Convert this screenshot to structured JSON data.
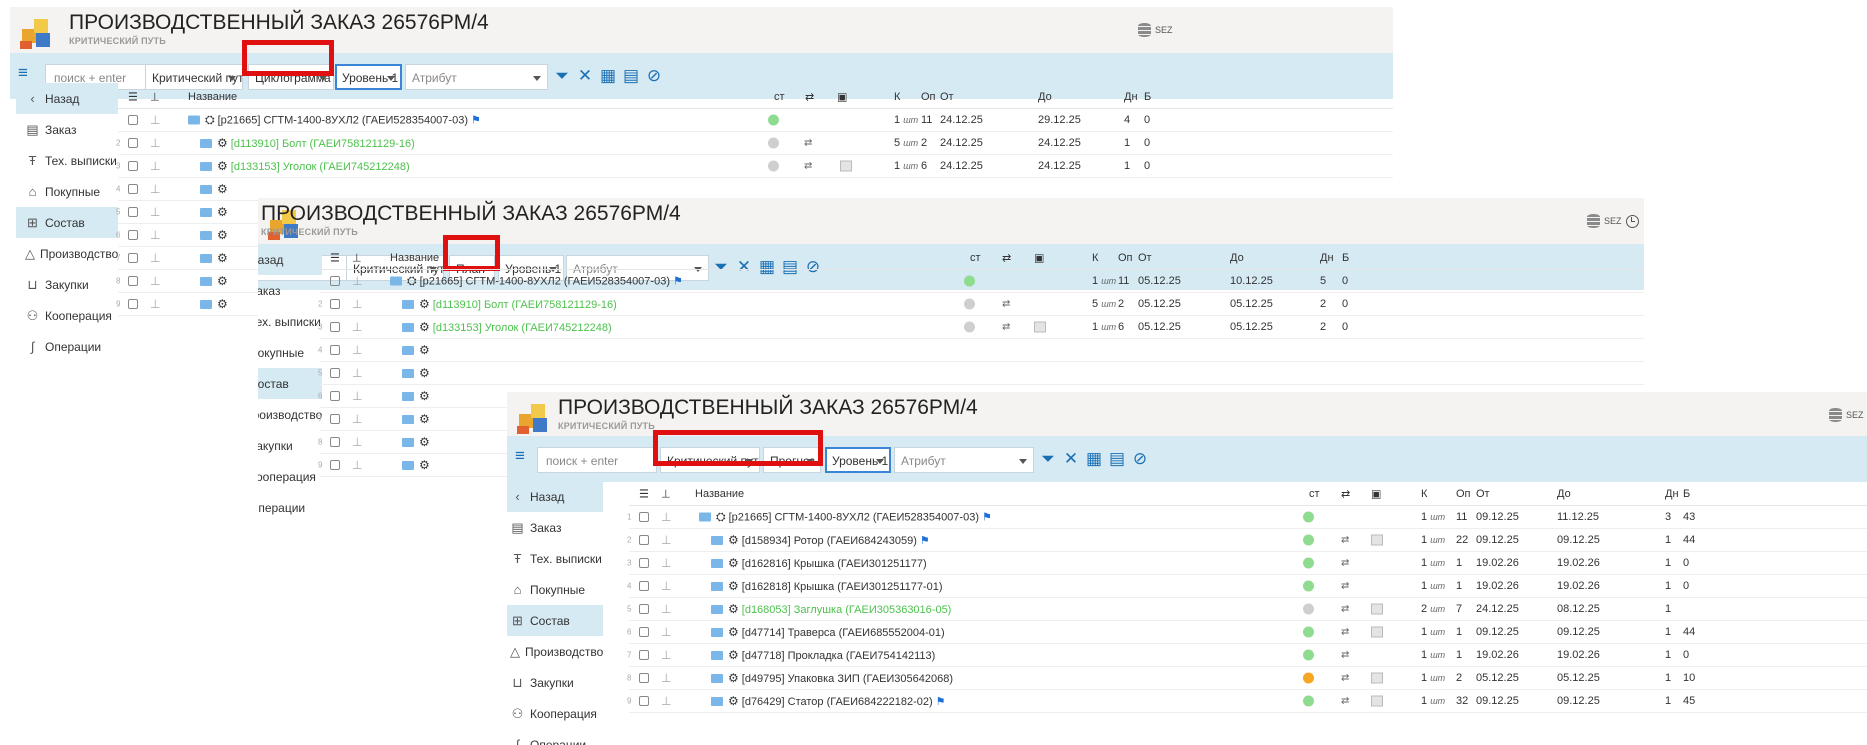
{
  "header": {
    "title": "ПРОИЗВОДСТВЕННЫЙ ЗАКАЗ 26576РМ/4",
    "subtitle": "КРИТИЧЕСКИЙ ПУТЬ",
    "db_label": "SEZ"
  },
  "toolbar": {
    "search_placeholder": "поиск + enter",
    "path": "Критический путь",
    "level": "Уровень 1",
    "attribute": "Атрибут"
  },
  "views": {
    "p1": "Циклограмма",
    "p2": "План",
    "p3": "Прогноз"
  },
  "sidebar": {
    "items": [
      {
        "label": "Назад",
        "icon": "chevron-left-icon"
      },
      {
        "label": "Заказ",
        "icon": "document-icon"
      },
      {
        "label": "Тех. выписки",
        "icon": "text-icon"
      },
      {
        "label": "Покупные",
        "icon": "bag-icon"
      },
      {
        "label": "Состав",
        "icon": "structure-icon"
      },
      {
        "label": "Производство",
        "icon": "shapes-icon"
      },
      {
        "label": "Закупки",
        "icon": "cart-icon"
      },
      {
        "label": "Кооперация",
        "icon": "people-icon"
      },
      {
        "label": "Операции",
        "icon": "operations-icon"
      }
    ]
  },
  "table": {
    "columns": {
      "name": "Название",
      "st": "ст",
      "k": "К",
      "op": "Оп",
      "from": "От",
      "to": "До",
      "days": "Дн",
      "b": "Б"
    },
    "unit": "шт"
  },
  "p1_rows": [
    {
      "n": "",
      "name": "[p21665] СГТМ-1400-8УХЛ2 (ГАЕИ528354007-03)",
      "green": false,
      "flag": true,
      "st": "g",
      "rs": false,
      "img": false,
      "k": "1",
      "op": "11",
      "from": "24.12.25",
      "to": "29.12.25",
      "d": "4",
      "b": "0",
      "lvl": 0
    },
    {
      "n": "2",
      "name": "[d113910] Болт (ГАЕИ758121129-16)",
      "green": true,
      "flag": false,
      "st": "gr",
      "rs": true,
      "img": false,
      "k": "5",
      "op": "2",
      "from": "24.12.25",
      "to": "24.12.25",
      "d": "1",
      "b": "0",
      "lvl": 1
    },
    {
      "n": "3",
      "name": "[d133153] Уголок (ГАЕИ745212248)",
      "green": true,
      "flag": false,
      "st": "gr",
      "rs": true,
      "img": true,
      "k": "1",
      "op": "6",
      "from": "24.12.25",
      "to": "24.12.25",
      "d": "1",
      "b": "0",
      "lvl": 1
    }
  ],
  "p2_rows": [
    {
      "n": "",
      "name": "[p21665] СГТМ-1400-8УХЛ2 (ГАЕИ528354007-03)",
      "green": false,
      "flag": true,
      "st": "g",
      "rs": false,
      "img": false,
      "k": "1",
      "op": "11",
      "from": "05.12.25",
      "to": "10.12.25",
      "d": "5",
      "b": "0",
      "lvl": 0
    },
    {
      "n": "2",
      "name": "[d113910] Болт (ГАЕИ758121129-16)",
      "green": true,
      "flag": false,
      "st": "gr",
      "rs": true,
      "img": false,
      "k": "5",
      "op": "2",
      "from": "05.12.25",
      "to": "05.12.25",
      "d": "2",
      "b": "0",
      "lvl": 1
    },
    {
      "n": "3",
      "name": "[d133153] Уголок (ГАЕИ745212248)",
      "green": true,
      "flag": false,
      "st": "gr",
      "rs": true,
      "img": true,
      "k": "1",
      "op": "6",
      "from": "05.12.25",
      "to": "05.12.25",
      "d": "2",
      "b": "0",
      "lvl": 1
    }
  ],
  "p3_rows": [
    {
      "n": "1",
      "name": "[p21665] СГТМ-1400-8УХЛ2 (ГАЕИ528354007-03)",
      "green": false,
      "flag": true,
      "st": "g",
      "rs": false,
      "img": false,
      "k": "1",
      "op": "11",
      "from": "09.12.25",
      "to": "11.12.25",
      "d": "3",
      "b": "43",
      "lvl": 0
    },
    {
      "n": "2",
      "name": "[d158934] Ротор (ГАЕИ684243059)",
      "green": false,
      "flag": true,
      "st": "g",
      "rs": true,
      "img": true,
      "k": "1",
      "op": "22",
      "from": "09.12.25",
      "to": "09.12.25",
      "d": "1",
      "b": "44",
      "lvl": 1
    },
    {
      "n": "3",
      "name": "[d162816] Крышка (ГАЕИ301251177)",
      "green": false,
      "flag": false,
      "st": "g",
      "rs": true,
      "img": false,
      "k": "1",
      "op": "1",
      "from": "19.02.26",
      "to": "19.02.26",
      "d": "1",
      "b": "0",
      "lvl": 1
    },
    {
      "n": "4",
      "name": "[d162818] Крышка (ГАЕИ301251177-01)",
      "green": false,
      "flag": false,
      "st": "g",
      "rs": true,
      "img": false,
      "k": "1",
      "op": "1",
      "from": "19.02.26",
      "to": "19.02.26",
      "d": "1",
      "b": "0",
      "lvl": 1
    },
    {
      "n": "5",
      "name": "[d168053] Заглушка (ГАЕИ305363016-05)",
      "green": true,
      "flag": false,
      "st": "gr",
      "rs": true,
      "img": true,
      "k": "2",
      "op": "7",
      "from": "24.12.25",
      "to": "08.12.25",
      "d": "1",
      "b": "",
      "lvl": 1
    },
    {
      "n": "6",
      "name": "[d47714] Траверса (ГАЕИ685552004-01)",
      "green": false,
      "flag": false,
      "st": "g",
      "rs": true,
      "img": true,
      "k": "1",
      "op": "1",
      "from": "09.12.25",
      "to": "09.12.25",
      "d": "1",
      "b": "44",
      "lvl": 1
    },
    {
      "n": "7",
      "name": "[d47718] Прокладка (ГАЕИ754142113)",
      "green": false,
      "flag": false,
      "st": "g",
      "rs": true,
      "img": false,
      "k": "1",
      "op": "1",
      "from": "19.02.26",
      "to": "19.02.26",
      "d": "1",
      "b": "0",
      "lvl": 1
    },
    {
      "n": "8",
      "name": "[d49795] Упаковка ЗИП (ГАЕИ305642068)",
      "green": false,
      "flag": false,
      "st": "o",
      "rs": true,
      "img": true,
      "k": "1",
      "op": "2",
      "from": "05.12.25",
      "to": "05.12.25",
      "d": "1",
      "b": "10",
      "lvl": 1
    },
    {
      "n": "9",
      "name": "[d76429] Статор (ГАЕИ684222182-02)",
      "green": false,
      "flag": true,
      "st": "g",
      "rs": true,
      "img": true,
      "k": "1",
      "op": "32",
      "from": "09.12.25",
      "to": "09.12.25",
      "d": "1",
      "b": "45",
      "lvl": 1
    }
  ],
  "colors": {
    "accent": "#1b6fb3",
    "toolbar_bg": "#d6eaf4",
    "highlight": "#e01010"
  }
}
